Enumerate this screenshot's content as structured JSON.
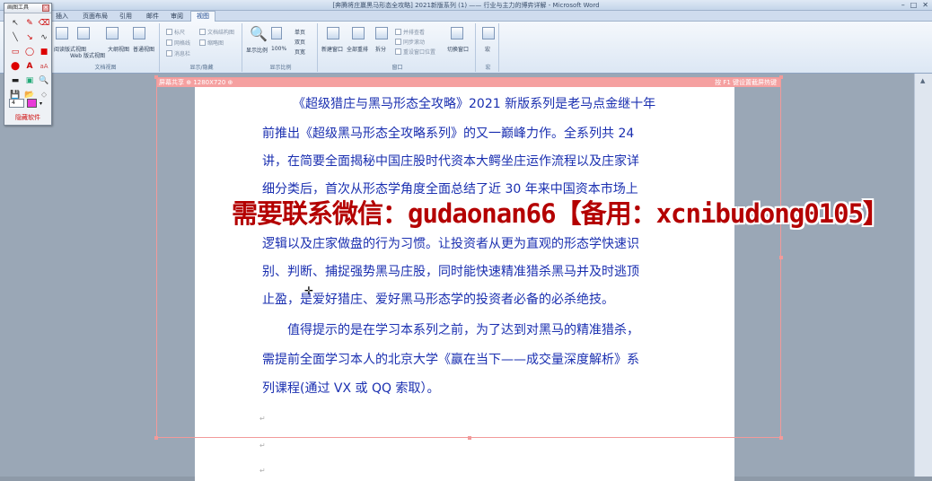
{
  "window": {
    "title": "[奔腾将庄赢黑马形态全攻略] 2021新版系列 (1) —— 行业与主力的博弈详解 - Microsoft Word",
    "minimize": "–",
    "maximize": "□",
    "close": "✕"
  },
  "tabs": [
    "插入",
    "页面布局",
    "引用",
    "邮件",
    "审阅",
    "视图"
  ],
  "active_tab_index": 5,
  "ribbon": {
    "views": {
      "label": "文档视图",
      "buttons": [
        "阅读版式视图",
        "Web 版式视图",
        "大纲视图",
        "普通视图"
      ]
    },
    "show_hide": {
      "label": "显示/隐藏",
      "options": [
        "标尺",
        "网格线",
        "消息栏",
        "文档结构图",
        "缩略图"
      ]
    },
    "zoom": {
      "label": "显示比例",
      "buttons": [
        "显示比例",
        "100%",
        "单页",
        "双页",
        "页宽"
      ]
    },
    "window": {
      "label": "窗口",
      "buttons": [
        "新建窗口",
        "全部重排",
        "拆分",
        "并排查看",
        "同步滚动",
        "重设窗口位置",
        "切换窗口"
      ]
    },
    "macros": {
      "label": "宏",
      "buttons": [
        "宏"
      ]
    }
  },
  "capture_toolbar": {
    "left_text": "屏幕共享 ⊕ 1280X720 ⊕",
    "right_text": "按 F1 键设置截屏热键"
  },
  "document": {
    "paragraphs": [
      "《超级猎庄与黑马形态全攻略》2021 新版系列是老马点金继十年",
      "前推出《超级黑马形态全攻略系列》的又一巅峰力作。全系列共  24",
      "讲，在简要全面揭秘中国庄股时代资本大鳄坐庄运作流程以及庄家详",
      "细分类后，首次从形态学角度全面总结了近 30 年来中国资本市场上",
      "逻辑以及庄家做盘的行为习惯。让投资者从更为直观的形态学快速识",
      "别、判断、捕捉强势黑马庄股，同时能快速精准猎杀黑马并及时逃顶",
      "止盈，是爱好猎庄、爱好黑马形态学的投资者必备的必杀绝技。",
      "值得提示的是在学习本系列之前，为了达到对黑马的精准猎杀，",
      "需提前全面学习本人的北京大学《赢在当下——成交量深度解析》系",
      "列课程(通过 VX 或 QQ 索取）。"
    ]
  },
  "watermark": {
    "text": "需要联系微信：gudaonan66【备用：xcnibudong0105】"
  },
  "palette": {
    "title": "画图工具",
    "width_value": "4",
    "color": "#e83ad8",
    "footer": "隐藏软件",
    "tools": [
      "pointer-icon",
      "pen-icon",
      "eraser-icon",
      "line-icon",
      "arrow-icon",
      "curve-icon",
      "rect-icon",
      "ellipse-icon",
      "filled-rect-icon",
      "filled-ellipse-icon",
      "text-icon",
      "highlighter-icon",
      "ruler-icon",
      "magnifier-icon",
      "zoom-icon",
      "save-icon",
      "folder-icon",
      "undo-icon"
    ]
  },
  "colors": {
    "doc_text": "#1a2fb0",
    "watermark": "#b40000",
    "capture_border": "#f29a9a"
  }
}
